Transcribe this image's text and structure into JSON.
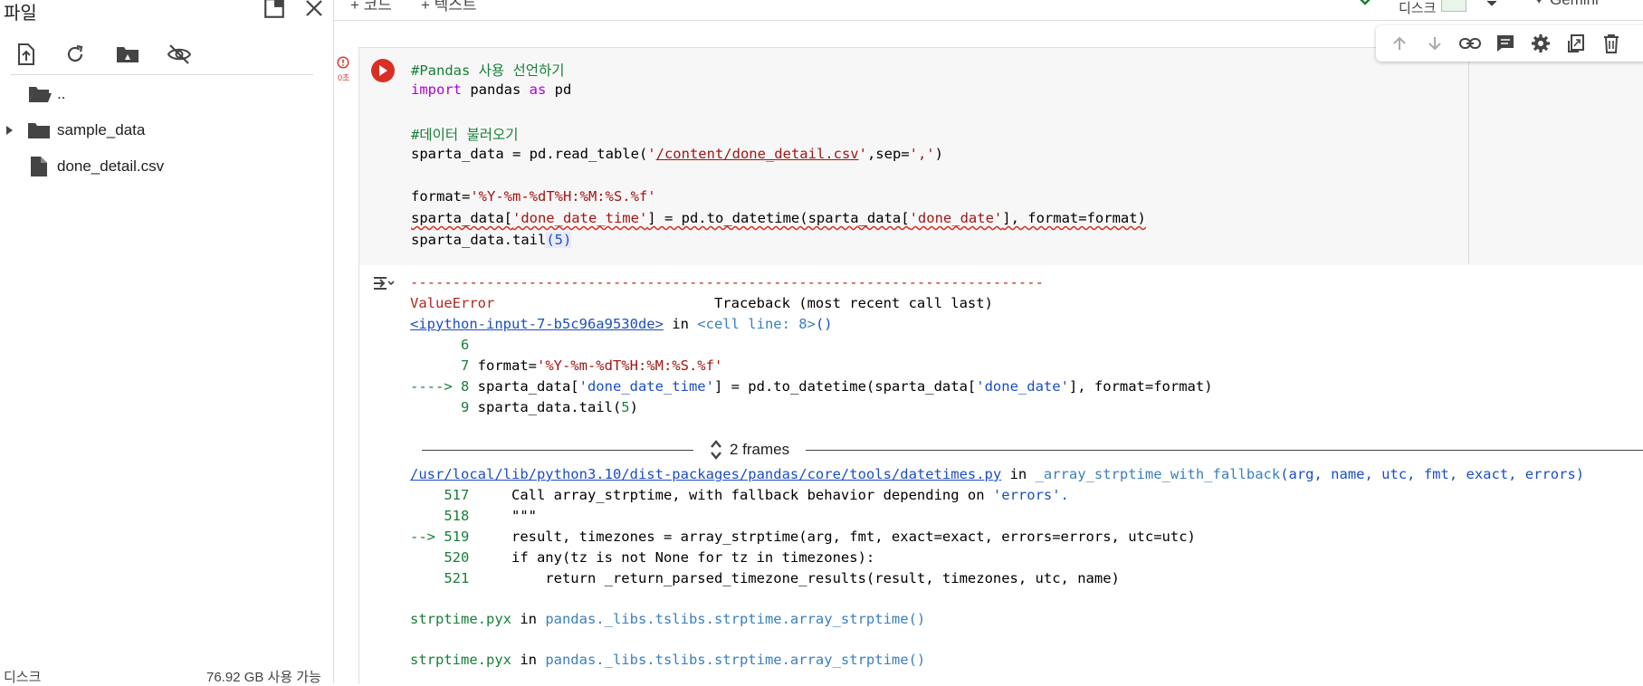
{
  "sidebar": {
    "title": "파일",
    "parent_dir": "..",
    "items": [
      {
        "label": "sample_data",
        "type": "folder"
      },
      {
        "label": "done_detail.csv",
        "type": "file"
      }
    ],
    "disk_label": "디스크",
    "disk_available": "76.92 GB 사용 가능"
  },
  "topbar": {
    "add_code": "+ 코드",
    "add_text": "+ 텍스트",
    "disk_label": "디스크",
    "gemini": "✦ Gemini"
  },
  "cell": {
    "exec_time": "0초",
    "code": {
      "line1": "#Pandas 사용 선언하기",
      "line2_kw": "import",
      "line2_a": " pandas ",
      "line2_kw2": "as",
      "line2_b": " pd",
      "line4": "#데이터 불러오기",
      "line5_a": "sparta_data = pd.read_table(",
      "line5_q1": "'",
      "line5_path": "/content/done_detail.csv",
      "line5_q2": "'",
      "line5_b": ",sep=",
      "line5_sep": "','",
      "line5_c": ")",
      "line7_a": "format=",
      "line7_str": "'%Y-%m-%dT%H:%M:%S.%f'",
      "line8_a": "sparta_data[",
      "line8_s1": "'done_date_time'",
      "line8_b": "] = pd.to_datetime(sparta_data[",
      "line8_s2": "'done_date'",
      "line8_c": "], format=format)",
      "line9_a": "sparta_data.tail",
      "line9_b": "(5)"
    }
  },
  "output": {
    "dashes": "---------------------------------------------------------------------------",
    "err_name": "ValueError",
    "err_tb": "                          Traceback (most recent call last)",
    "input_link": "<ipython-input-7-b5c96a9530de>",
    "in_word": " in ",
    "cell_line": "<cell line: 8>",
    "cell_parens": "()",
    "l6": "      6",
    "l7_num": "      7 ",
    "l7_a": "format=",
    "l7_str": "'%Y-%m-%dT%H:%M:%S.%f'",
    "l8_arrow": "----> 8 ",
    "l8_a": "sparta_data[",
    "l8_s1": "'done_date_time'",
    "l8_b": "] = pd.to_datetime(sparta_data[",
    "l8_s2": "'done_date'",
    "l8_c": "], format=format)",
    "l9_num": "      9 ",
    "l9_a": "sparta_data.tail(",
    "l9_n": "5",
    "l9_b": ")",
    "frames_label": "2 frames",
    "dt_path": "/usr/local/lib/python3.10/dist-packages/pandas/core/tools/datetimes.py",
    "dt_func": "_array_strptime_with_fallback",
    "dt_args": "(arg, name, utc, fmt, exact, errors)",
    "l517_num": "    517 ",
    "l517_txt": "    Call array_strptime, with fallback behavior depending on ",
    "l517_str": "'errors'.",
    "l518_num": "    518 ",
    "l518_txt": "    \"\"\"",
    "l519_arrow": "--> 519 ",
    "l519_txt": "    result, timezones = array_strptime(arg, fmt, exact=exact, errors=errors, utc=utc)",
    "l520_num": "    520 ",
    "l520_txt": "    if any(tz is not None for tz in timezones):",
    "l521_num": "    521 ",
    "l521_txt": "        return _return_parsed_timezone_results(result, timezones, utc, name)",
    "pyx_file": "strptime.pyx",
    "pyx_func": "pandas._libs.tslibs.strptime.array_strptime()"
  },
  "icons": {
    "upload": "upload-file-icon",
    "refresh": "refresh-icon",
    "drive": "mount-drive-icon",
    "hidden": "hide-files-icon"
  }
}
